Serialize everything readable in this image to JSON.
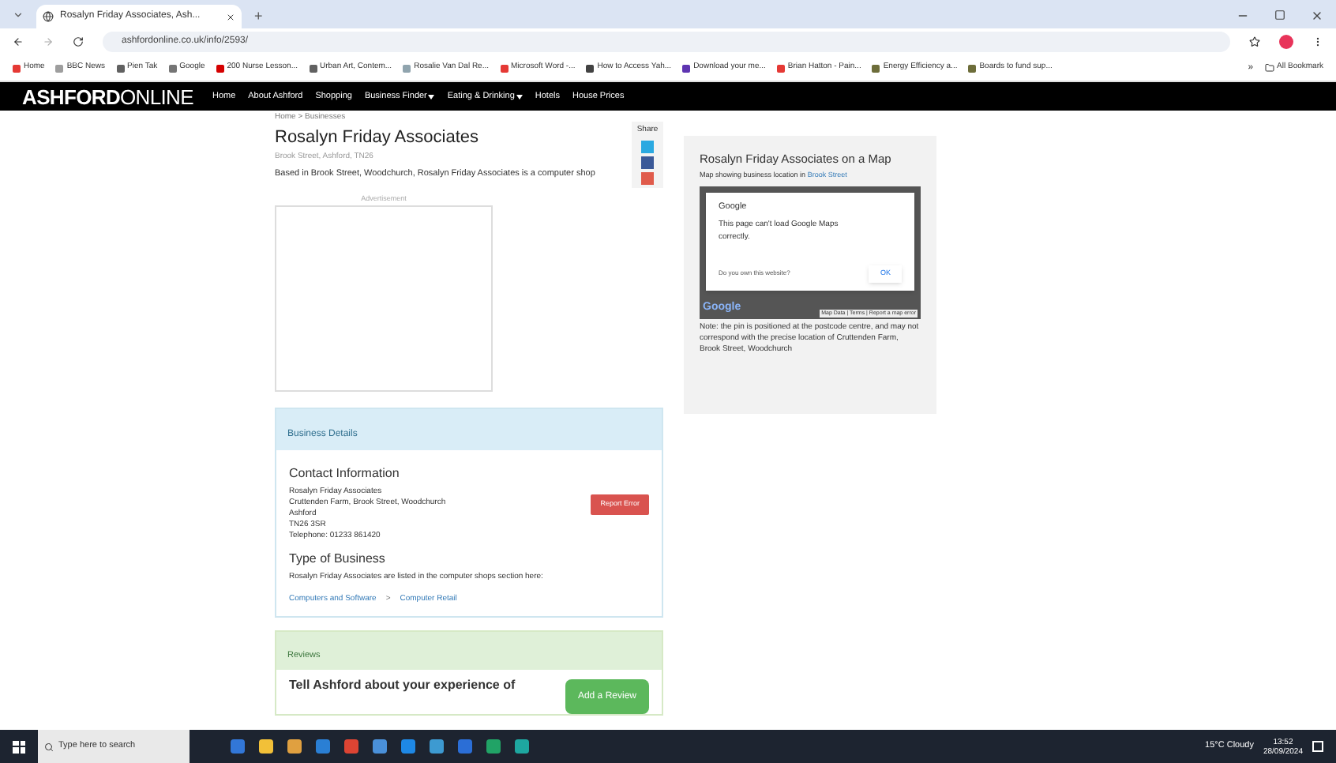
{
  "browser": {
    "tab_title": "Rosalyn Friday Associates, Ash...",
    "new_tab": "+",
    "url": "ashfordonline.co.uk/info/2593/",
    "bookmarks": [
      {
        "label": "Home",
        "color": "#e53935"
      },
      {
        "label": "BBC News",
        "color": "#9e9e9e"
      },
      {
        "label": "Pien Tak",
        "color": "#616161"
      },
      {
        "label": "Google",
        "color": "#757575"
      },
      {
        "label": "200 Nurse Lesson...",
        "color": "#d50000"
      },
      {
        "label": "Urban Art, Contem...",
        "color": "#616161"
      },
      {
        "label": "Rosalie Van Dal Re...",
        "color": "#90a4ae"
      },
      {
        "label": "Microsoft Word -...",
        "color": "#e53935"
      },
      {
        "label": "How to Access Yah...",
        "color": "#424242"
      },
      {
        "label": "Download your me...",
        "color": "#5e35b1"
      },
      {
        "label": "Brian Hatton - Pain...",
        "color": "#e53935"
      },
      {
        "label": "Energy Efficiency a...",
        "color": "#6d6d3a"
      },
      {
        "label": "Boards to fund sup...",
        "color": "#6d6d3a"
      }
    ],
    "more": "»",
    "all_bookmarks": "All Bookmark"
  },
  "site": {
    "logo_bold": "ASHFORD",
    "logo_light": "ONLINE",
    "nav": [
      {
        "label": "Home",
        "dropdown": false
      },
      {
        "label": "About Ashford",
        "dropdown": false
      },
      {
        "label": "Shopping",
        "dropdown": false
      },
      {
        "label": "Business Finder",
        "dropdown": true
      },
      {
        "label": "Eating & Drinking",
        "dropdown": true
      },
      {
        "label": "Hotels",
        "dropdown": false
      },
      {
        "label": "House Prices",
        "dropdown": false
      }
    ]
  },
  "page": {
    "breadcrumb": "Home > Businesses",
    "title": "Rosalyn Friday Associates",
    "address_line": "Brook Street, Ashford, TN26",
    "intro": "Based in Brook Street, Woodchurch, Rosalyn Friday Associates is a computer shop",
    "advert_label": "Advertisement",
    "share_label": "Share",
    "details": {
      "heading": "Business Details",
      "contact_heading": "Contact Information",
      "contact_lines": [
        "Rosalyn Friday Associates",
        "Cruttenden Farm, Brook Street, Woodchurch",
        "Ashford",
        "TN26 3SR",
        "Telephone: 01233 861420"
      ],
      "report_button": "Report Error",
      "type_heading": "Type of Business",
      "type_text": "Rosalyn Friday Associates are listed in the computer shops section here:",
      "category": "Computers and Software",
      "separator": ">",
      "subcategory": "Computer Retail"
    },
    "reviews": {
      "heading": "Reviews",
      "prompt": "Tell Ashford about your experience of",
      "add_button": "Add a Review"
    },
    "map": {
      "title": "Rosalyn Friday Associates on a Map",
      "caption": "Map showing business location in",
      "caption_link": "Brook Street",
      "dialog_title": "Google",
      "dialog_message": "This page can't load Google Maps correctly.",
      "dialog_question": "Do you own this website?",
      "dialog_ok": "OK",
      "map_logo": "Google",
      "map_footer": "Map Data | Terms | Report a map error",
      "note": "Note: the pin is positioned at the postcode centre, and may not correspond with the precise location of Cruttenden Farm, Brook Street, Woodchurch"
    }
  },
  "taskbar": {
    "search_placeholder": "Type here to search",
    "weather": "15°C Cloudy",
    "time": "13:52",
    "date": "28/09/2024"
  }
}
